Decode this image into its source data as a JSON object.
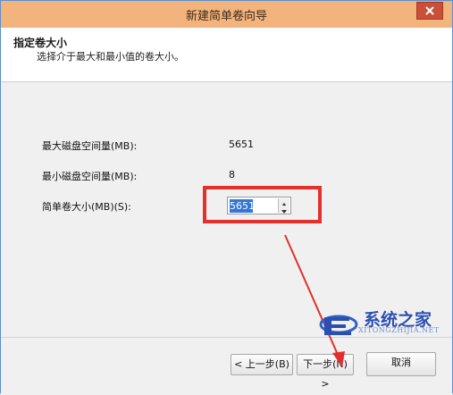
{
  "window": {
    "title": "新建简单卷向导"
  },
  "header": {
    "title": "指定卷大小",
    "subtitle": "选择介于最大和最小值的卷大小。"
  },
  "form": {
    "max_label": "最大磁盘空间量(MB):",
    "max_value": "5651",
    "min_label": "最小磁盘空间量(MB):",
    "min_value": "8",
    "size_label": "简单卷大小(MB)(S):",
    "size_value": "5651"
  },
  "buttons": {
    "back": "< 上一步(B)",
    "next": "下一步(N) >",
    "cancel": "取消"
  },
  "watermark": {
    "brand": "系统之家",
    "url": "XITONGZHIJIA.NET"
  },
  "colors": {
    "highlight": "#e2302d",
    "titlebar": "#f3b37c",
    "close": "#c94f38"
  }
}
